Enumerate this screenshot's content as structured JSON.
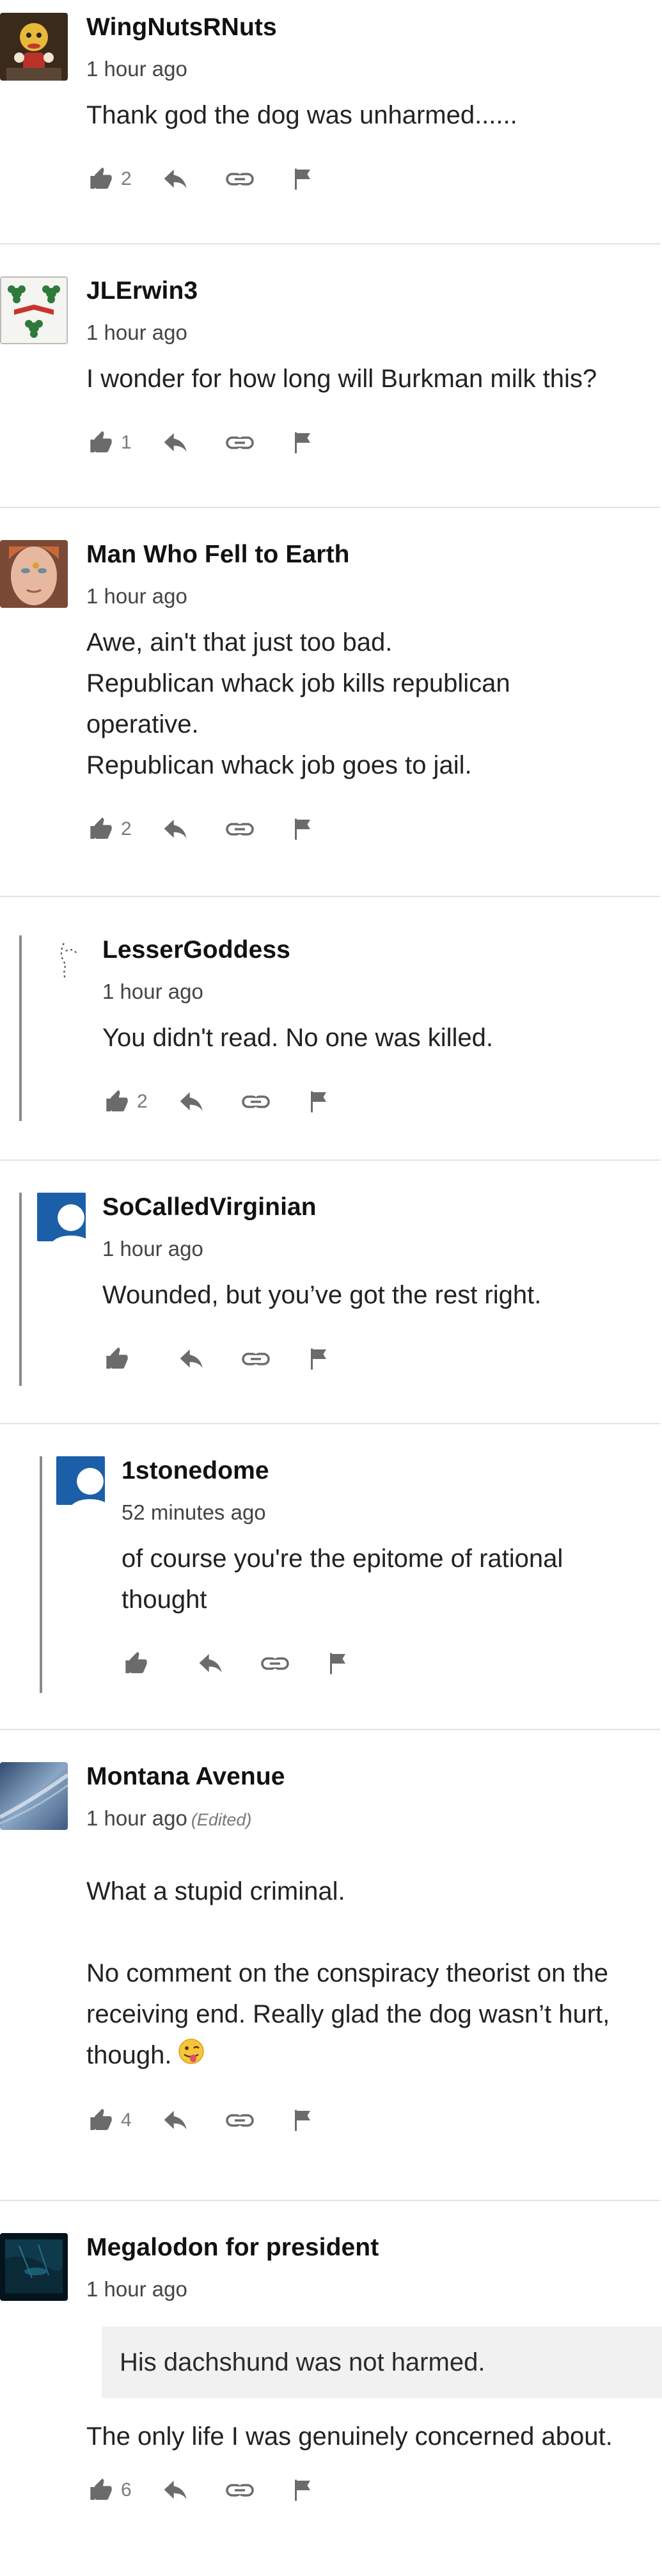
{
  "comments": [
    {
      "author": "WingNutsRNuts",
      "time": "1 hour ago",
      "lines": [
        "Thank god the dog was unharmed......"
      ],
      "likes": "2"
    },
    {
      "author": "JLErwin3",
      "time": "1 hour ago",
      "lines": [
        "I wonder for how long will Burkman milk this?"
      ],
      "likes": "1"
    },
    {
      "author": "Man Who Fell to Earth",
      "time": "1 hour ago",
      "lines": [
        "Awe, ain't that just too bad.",
        "Republican whack job kills republican",
        "operative.",
        "Republican whack job goes to jail."
      ],
      "likes": "2"
    },
    {
      "author": "LesserGoddess",
      "time": "1 hour ago",
      "lines": [
        "You didn't read. No one was killed."
      ],
      "likes": "2"
    },
    {
      "author": "SoCalledVirginian",
      "time": "1 hour ago",
      "lines": [
        "Wounded, but you’ve got the rest right."
      ],
      "likes": ""
    },
    {
      "author": "1stonedome",
      "time": "52 minutes ago",
      "lines": [
        "of course you're the epitome of rational",
        "thought"
      ],
      "likes": ""
    },
    {
      "author": "Montana Avenue",
      "time": "1 hour ago",
      "edited": "(Edited)",
      "lines": [
        "What a stupid criminal.",
        "",
        "No comment on the conspiracy theorist on the",
        "receiving end. Really glad the dog wasn’t hurt,",
        "though."
      ],
      "likes": "4"
    },
    {
      "author": "Megalodon for president",
      "time": "1 hour ago",
      "quote": "His dachshund was not harmed.",
      "lines": [
        "The only life I was genuinely concerned about."
      ],
      "likes": "6"
    }
  ],
  "icons": {
    "like": "thumbs-up-icon",
    "reply": "reply-icon",
    "link": "link-icon",
    "flag": "flag-icon"
  },
  "colors": {
    "icon": "#6b6b6b",
    "separator": "#e2e2e2",
    "thread_line": "#8a8a8a",
    "default_avatar": "#1a5fa8"
  }
}
